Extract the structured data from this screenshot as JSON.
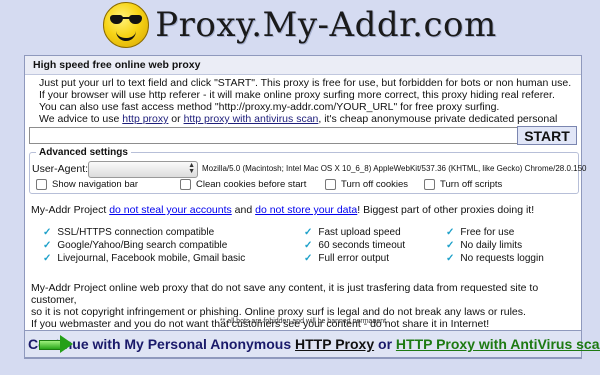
{
  "header": {
    "logo_text": "Proxy.My-Addr.com",
    "logo_icon": "smiley-sunglasses-icon"
  },
  "panel": {
    "title": "High speed free online web proxy",
    "intro": [
      "Just put your url to text field and click \"START\". This proxy is free for use, but forbidden for bots or non human use.",
      "If your browser will use http referer - it will make online proxy surfing more correct, this proxy hiding real referer.",
      "You can also use fast access method \"http://proxy.my-addr.com/YOUR_URL\" for free proxy surfing."
    ],
    "intro_last": {
      "prefix": "We advice to use ",
      "link1": "http proxy",
      "mid": " or ",
      "link2": "http proxy with antivirus scan",
      "suffix": ", it's cheap anonymouse private dedicated personal proxy."
    },
    "url_input": {
      "value": "",
      "placeholder": ""
    },
    "start_label": "START"
  },
  "advanced": {
    "title": "Advanced settings",
    "ua_label": "User-Agent:",
    "ua_value": "Mozilla/5.0 (Macintosh; Intel Mac OS X 10_6_8) AppleWebKit/537.36 (KHTML, like Gecko) Chrome/28.0.150",
    "checkboxes": [
      "Show navigation bar",
      "Clean cookies before start",
      "Turn off cookies",
      "Turn off scripts"
    ]
  },
  "warning": {
    "prefix": "My-Addr Project ",
    "link1": "do not steal your accounts",
    "mid": " and ",
    "link2": "do not store your data",
    "suffix": "! Biggest part of other proxies doing it!"
  },
  "features": {
    "col1": [
      "SSL/HTTPS connection compatible",
      "Google/Yahoo/Bing search compatible",
      "Livejournal, Facebook mobile, Gmail basic"
    ],
    "col2": [
      "Fast upload speed",
      "60 seconds timeout",
      "Full error output"
    ],
    "col3": [
      "Free for use",
      "No daily limits",
      "No requests loggin"
    ]
  },
  "about": [
    "My-Addr Project online web proxy that do not save any content, it is just trasfering data from requested site to customer,",
    "so it is not copyright infringement or phishing. Online proxy surf is legal and do not break any laws or rules.",
    "If you webmaster and you do not want that customers see your content - do not share it in Internet!"
  ],
  "note": "** all bots are fobidden and will be banned permanent",
  "continue": {
    "prefix": "Continue with My Personal Anonymous ",
    "link1": "HTTP Proxy",
    "mid": " or ",
    "link2": "HTTP Proxy with AntiVirus scan"
  },
  "colors": {
    "background": "#d5dbf1",
    "panel_border": "#8f99bd",
    "check": "#1da0c9",
    "green_link": "#1d7a12"
  }
}
